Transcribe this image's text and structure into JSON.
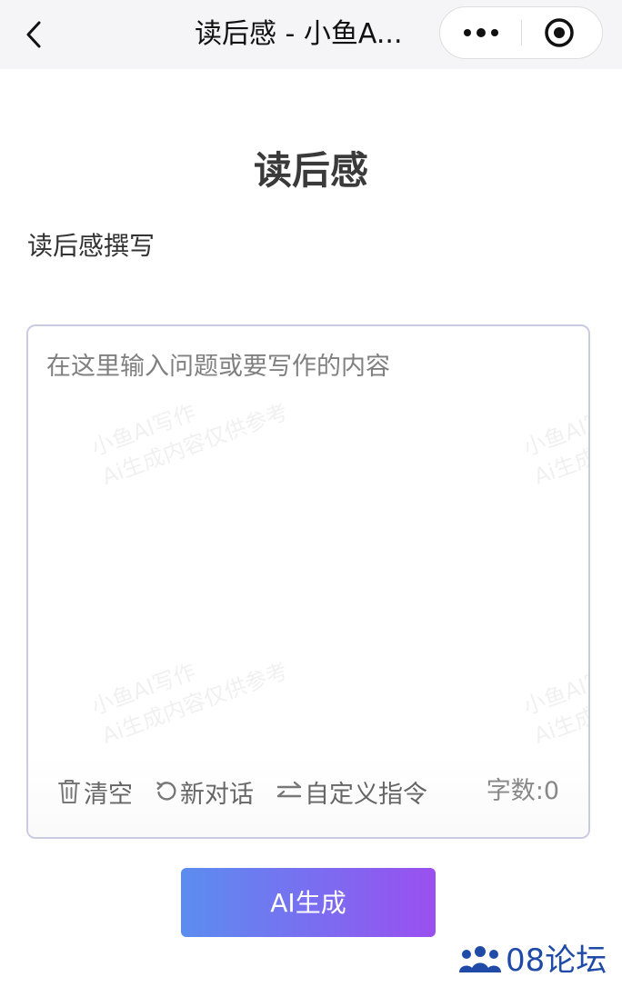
{
  "navbar": {
    "title": "读后感 - 小鱼A...",
    "back_icon": "chevron-left-icon",
    "more_icon": "more-dots-icon",
    "close_icon": "target-circle-icon"
  },
  "page": {
    "title": "读后感",
    "subtitle": "读后感撰写"
  },
  "editor": {
    "placeholder": "在这里输入问题或要写作的内容",
    "value": "",
    "watermark_line1": "小鱼AI写作",
    "watermark_line2": "Ai生成内容仅供参考"
  },
  "toolbar": {
    "clear_label": "清空",
    "new_chat_label": "新对话",
    "custom_prompt_label": "自定义指令",
    "count_label": "字数:0"
  },
  "generate_button": {
    "label": "AI生成",
    "gradient_start": "#5b8def",
    "gradient_end": "#9b4ff0"
  },
  "forum_logo": {
    "text": "08论坛",
    "color": "#1f4aa8"
  }
}
